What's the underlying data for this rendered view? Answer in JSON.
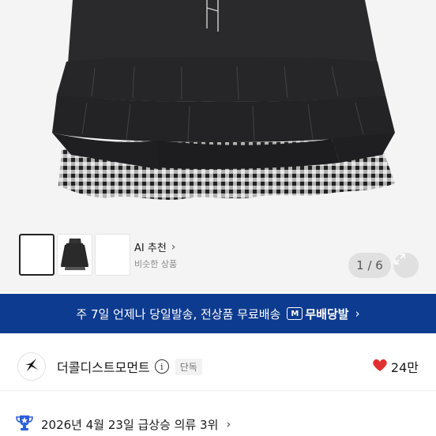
{
  "gallery": {
    "ai_title": "AI 추천",
    "ai_chevron": "›",
    "ai_subtitle": "비슷한 상품",
    "counter": "1 / 6",
    "icons": {
      "expand": "expand-icon"
    }
  },
  "banner": {
    "text": "주 7일 언제나 당일발송, 전상품 무료배송",
    "badge_icon_text": "M",
    "badge_label": "무배당발",
    "chevron": "›",
    "color": "#0d3b8f"
  },
  "brand": {
    "name": "더콜디스트모먼트",
    "info_icon": "i",
    "exclusive_label": "단독",
    "like_count": "24만",
    "heart_color": "#e03131"
  },
  "ranking": {
    "text": "2026년 4월 23일 급상승 의류 3위",
    "chevron": "›"
  }
}
